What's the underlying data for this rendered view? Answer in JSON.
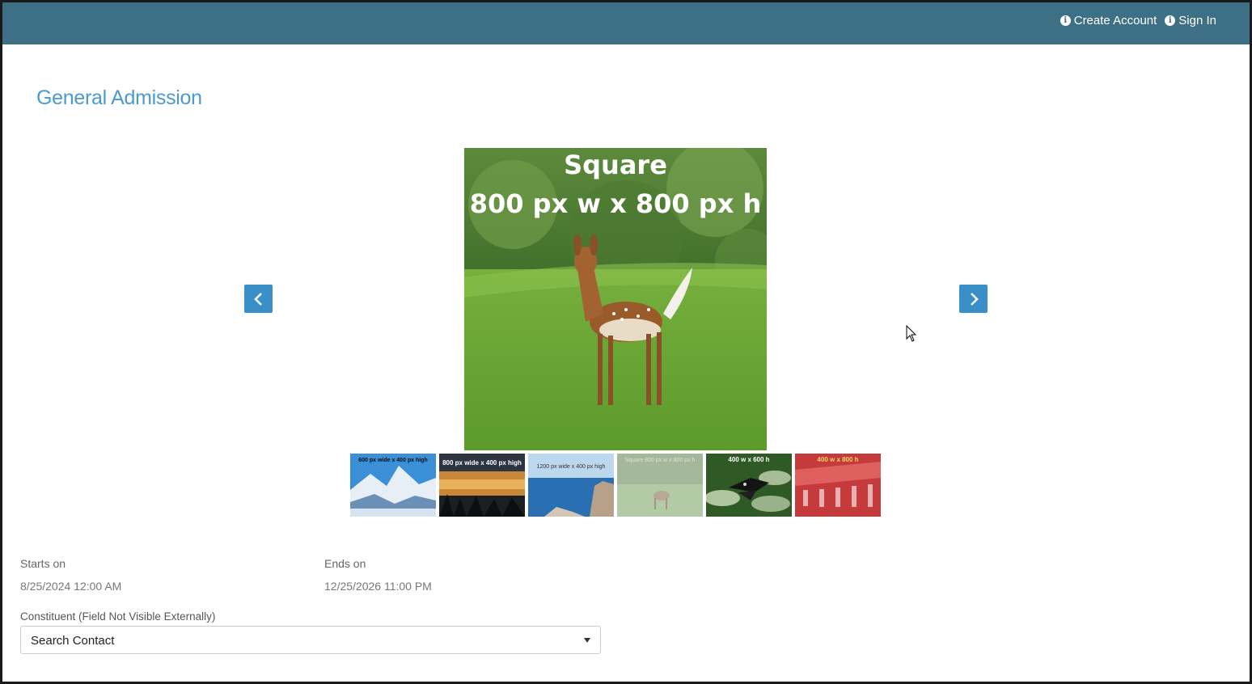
{
  "header": {
    "create_account": "Create Account",
    "sign_in": "Sign In",
    "bar_color": "#3d7085"
  },
  "page": {
    "title": "General Admission",
    "accent_color": "#4a9ad0"
  },
  "carousel": {
    "prev_icon": "chevron-left-icon",
    "next_icon": "chevron-right-icon",
    "main_image": {
      "line1": "Square",
      "line2": "800 px w x 800 px h"
    },
    "thumbnails": [
      {
        "text": "600 px wide x 400 px high",
        "scene": "mountain"
      },
      {
        "text": "800 px wide x 400 px high",
        "scene": "sunset"
      },
      {
        "text": "1200 px wide x 400 px high",
        "scene": "ocean"
      },
      {
        "text": "Square 800 px w x 800 px h",
        "scene": "deer",
        "selected": true
      },
      {
        "text": "400 w x 600 h",
        "scene": "butterfly"
      },
      {
        "text": "400 w x 800 h",
        "scene": "building"
      }
    ]
  },
  "details": {
    "starts_label": "Starts on",
    "starts_value": "8/25/2024 12:00 AM",
    "ends_label": "Ends on",
    "ends_value": "12/25/2026 11:00 PM",
    "constituent_label": "Constituent (Field Not Visible Externally)",
    "constituent_value": "Search Contact"
  }
}
